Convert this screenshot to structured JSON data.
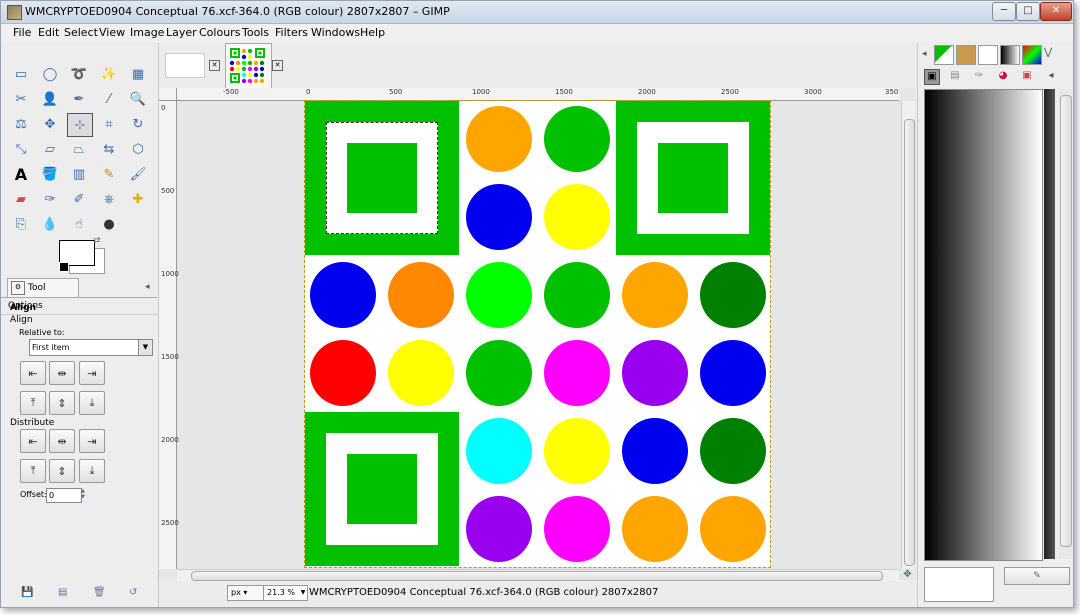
{
  "window": {
    "title": "WMCRYPTOED0904 Conceptual 76.xcf-364.0 (RGB colour) 2807x2807 – GIMP",
    "min": "─",
    "max": "□",
    "close": "✕"
  },
  "menu": [
    "File",
    "Edit",
    "Select",
    "View",
    "Image",
    "Layer",
    "Colours",
    "Tools",
    "Filters",
    "Windows",
    "Help"
  ],
  "tool_options": {
    "tab_label": "Tool Options",
    "heading": "Align",
    "subheading": "Align",
    "relative_label": "Relative to:",
    "relative_value": "First item",
    "distribute_label": "Distribute",
    "offset_label": "Offset:",
    "offset_value": "0"
  },
  "image_tabs": {
    "close_symbol": "✕"
  },
  "rulers": {
    "h": [
      "-500",
      "0",
      "500",
      "1000",
      "1500",
      "2000",
      "2500",
      "3000",
      "350"
    ],
    "v": [
      "0",
      "500",
      "1000",
      "1500",
      "2000",
      "2500"
    ]
  },
  "image": {
    "squares": [
      "top-left",
      "top-right",
      "bottom-left"
    ],
    "circles": [
      {
        "color": "#ffa500"
      },
      {
        "color": "#00c000"
      },
      {
        "color": "#0000ee"
      },
      {
        "color": "#ffff00"
      },
      {
        "color": "#0000ee"
      },
      {
        "color": "#ff8800"
      },
      {
        "color": "#00ff00"
      },
      {
        "color": "#00c000"
      },
      {
        "color": "#ffa500"
      },
      {
        "color": "#008000"
      },
      {
        "color": "#ff0000"
      },
      {
        "color": "#ffff00"
      },
      {
        "color": "#00c000"
      },
      {
        "color": "#ff00ff"
      },
      {
        "color": "#9900ee"
      },
      {
        "color": "#0000ee"
      },
      {
        "color": "#00ffff"
      },
      {
        "color": "#ffff00"
      },
      {
        "color": "#0000ee"
      },
      {
        "color": "#008000"
      },
      {
        "color": "#9900ee"
      },
      {
        "color": "#ff00ff"
      },
      {
        "color": "#ffa500"
      },
      {
        "color": "#ffa500"
      }
    ]
  },
  "status": {
    "unit": "px",
    "zoom": "21.3 %",
    "text": "WMCRYPTOED0904 Conceptual 76.xcf-364.0 (RGB colour) 2807x2807"
  }
}
